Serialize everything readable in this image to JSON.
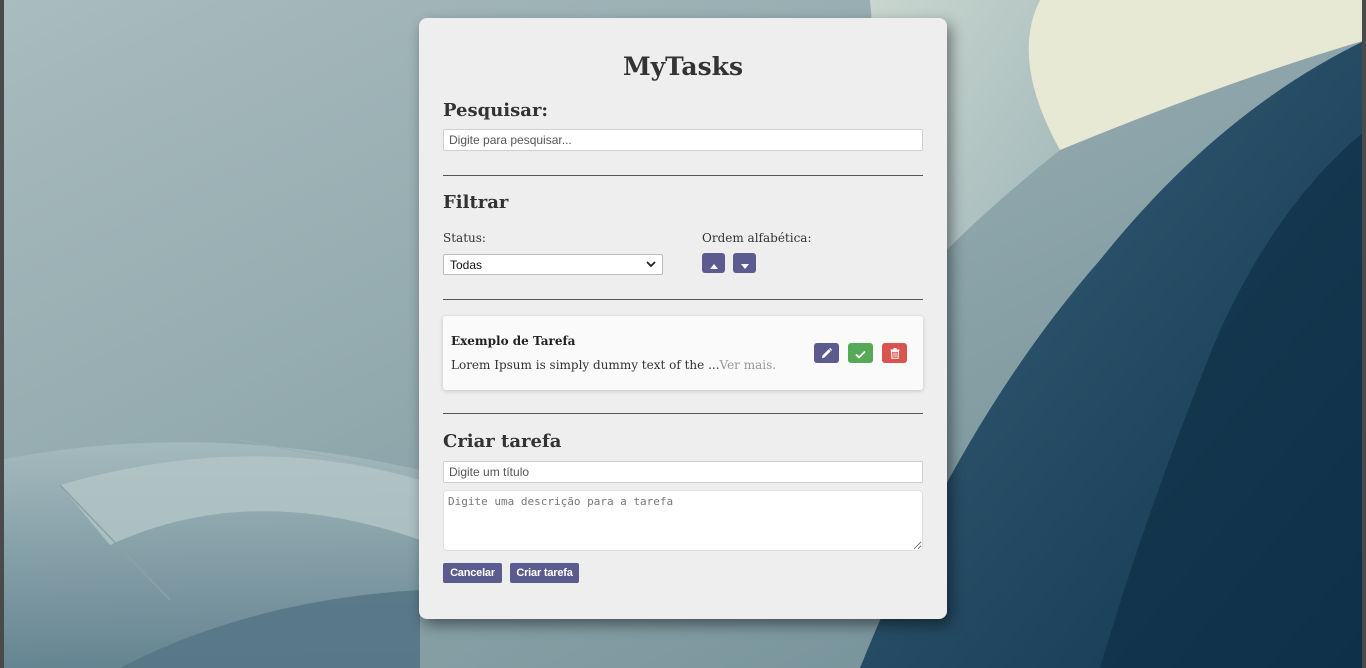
{
  "app": {
    "title": "MyTasks"
  },
  "search": {
    "heading": "Pesquisar:",
    "placeholder": "Digite para pesquisar..."
  },
  "filter": {
    "heading": "Filtrar",
    "status_label": "Status:",
    "status_selected": "Todas",
    "order_label": "Ordem alfabética:",
    "sort_up_icon": "caret-up-icon",
    "sort_down_icon": "caret-down-icon"
  },
  "tasks": [
    {
      "title": "Exemplo de Tarefa",
      "description": "Lorem Ipsum is simply dummy text of the ...",
      "more_label": "Ver mais.",
      "actions": [
        "pencil-icon",
        "check-icon",
        "trash-icon"
      ]
    }
  ],
  "create": {
    "heading": "Criar tarefa",
    "title_placeholder": "Digite um título",
    "description_placeholder": "Digite uma descrição para a tarefa",
    "cancel_label": "Cancelar",
    "submit_label": "Criar tarefa"
  },
  "colors": {
    "primary": "#5b5b8f",
    "success": "#56a957",
    "danger": "#d9534f",
    "card": "#eeeeee"
  }
}
